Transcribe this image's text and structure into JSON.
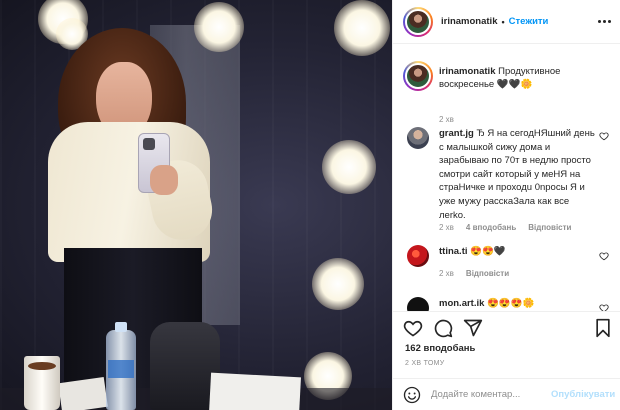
{
  "header": {
    "username": "irinamonatik",
    "separator": "•",
    "follow_label": "Стежити",
    "more_icon": "more-options-icon"
  },
  "caption": {
    "username": "irinamonatik",
    "text": " Продуктивное воскресенье 🖤🖤🌼",
    "time": "2 хв"
  },
  "comments": [
    {
      "username": "grant.jg",
      "text": " Ђ Я на сегодНЯшний день с малышкой сижу дома и зарабываю по 70т в недлю просто смотри сайт который у меНЯ на страНичке и проходu 0nросы Я и уже мужу расскаЗала как все лerko.",
      "time": "2 хв",
      "likes": "4 вподобань",
      "reply": "Відповісти"
    },
    {
      "username": "ttina.ti",
      "text": " 😍😍🖤",
      "time": "2 хв",
      "reply": "Відповісти"
    },
    {
      "username": "mon.art.ik",
      "text": " 😍😍😍🌼"
    }
  ],
  "actions": {
    "like_icon": "heart-icon",
    "comment_icon": "comment-icon",
    "share_icon": "share-icon",
    "bookmark_icon": "bookmark-icon",
    "likes": "162 вподобань",
    "time_ago": "2 ХВ ТОМУ"
  },
  "add_comment": {
    "emoji_icon": "emoji-icon",
    "placeholder": "Додайте коментар...",
    "publish_label": "Опублікувати"
  },
  "colors": {
    "accent": "#0095f6",
    "publish_disabled": "#b2dffc",
    "secondary_text": "#8e8e8e",
    "primary_text": "#262626"
  }
}
